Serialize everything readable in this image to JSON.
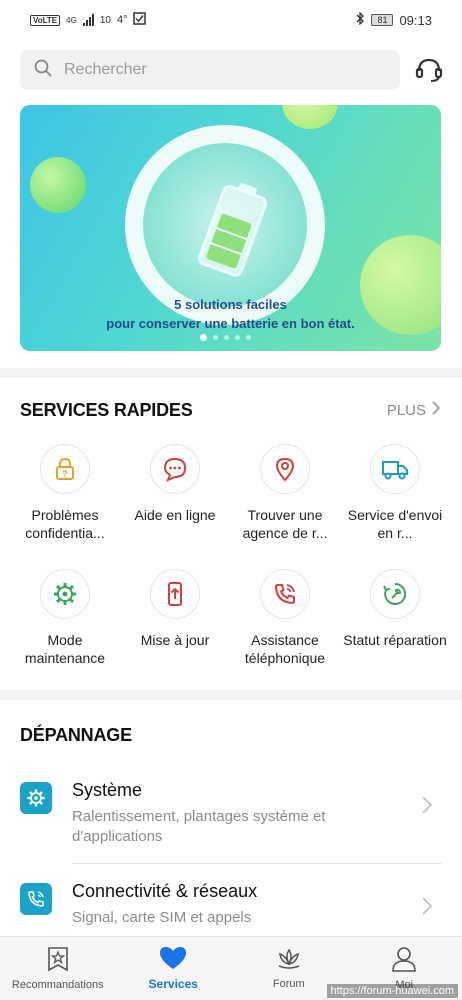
{
  "status_bar": {
    "volte": "VoLTE",
    "network": "4G",
    "data_rate": "10",
    "temp": "4°",
    "battery": "81",
    "time": "09:13"
  },
  "search": {
    "placeholder": "Rechercher"
  },
  "banner": {
    "line1": "5 solutions faciles",
    "line2": "pour conserver une batterie en bon état.",
    "slide_count": 5,
    "active_slide": 1
  },
  "services": {
    "title": "SERVICES RAPIDES",
    "more_label": "PLUS",
    "items": [
      {
        "label": "Problèmes confidentia...",
        "icon": "lock-question-icon",
        "color": "#e3a22a"
      },
      {
        "label": "Aide en ligne",
        "icon": "chat-bubble-icon",
        "color": "#d0413b"
      },
      {
        "label": "Trouver une agence de r...",
        "icon": "location-pin-icon",
        "color": "#d0413b"
      },
      {
        "label": "Service d'envoi en r...",
        "icon": "truck-icon",
        "color": "#1a9dc4"
      },
      {
        "label": "Mode maintenance",
        "icon": "gear-wrench-icon",
        "color": "#3aa55a"
      },
      {
        "label": "Mise à jour",
        "icon": "phone-update-icon",
        "color": "#d0413b"
      },
      {
        "label": "Assistance téléphonique",
        "icon": "phone-call-icon",
        "color": "#d0413b"
      },
      {
        "label": "Statut réparation",
        "icon": "repair-status-icon",
        "color": "#3aa55a"
      }
    ]
  },
  "troubleshooting": {
    "title": "DÉPANNAGE",
    "items": [
      {
        "title": "Système",
        "subtitle": "Ralentissement, plantages système et d'applications"
      },
      {
        "title": "Connectivité & réseaux",
        "subtitle": "Signal, carte SIM et appels"
      }
    ]
  },
  "bottom_nav": [
    {
      "label": "Recommandations",
      "icon": "star-badge-icon"
    },
    {
      "label": "Services",
      "icon": "heart-icon",
      "active": true
    },
    {
      "label": "Forum",
      "icon": "lotus-icon"
    },
    {
      "label": "Moi",
      "icon": "person-icon"
    }
  ],
  "watermark": "https://forum-huawei.com",
  "colors": {
    "accent": "#1a73e8",
    "icon_bg": "#1aa3c9"
  }
}
